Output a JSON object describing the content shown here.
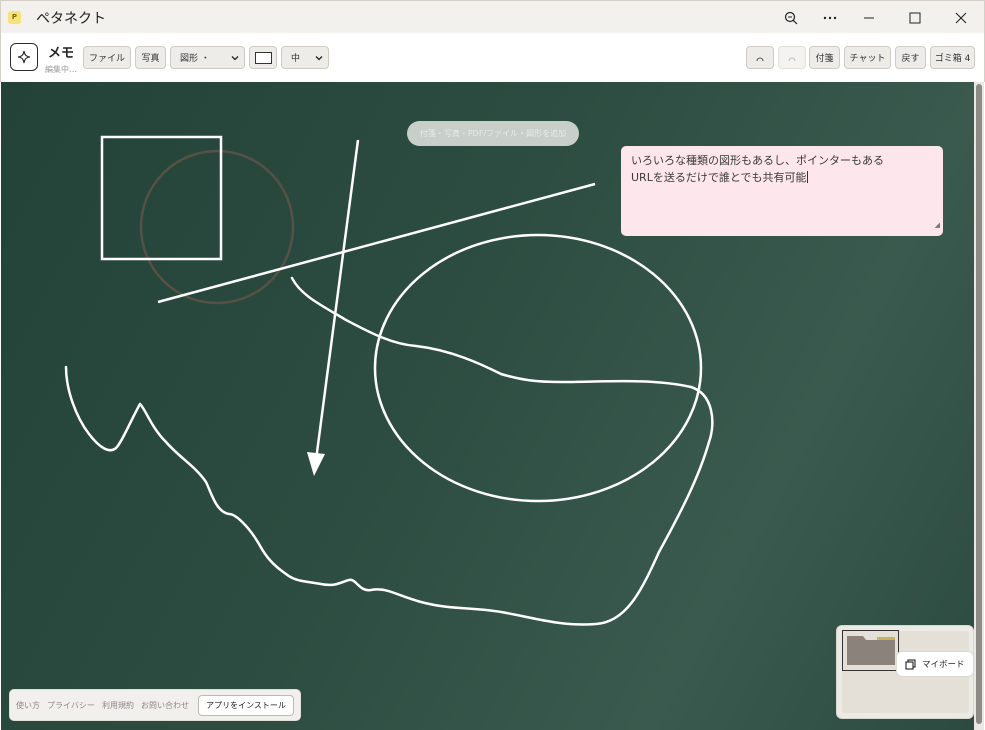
{
  "window": {
    "app_icon_letter": "P",
    "title": "ペタネクト"
  },
  "toolbar": {
    "memo_title": "メモ",
    "memo_status": "編集中…",
    "file_label": "ファイル",
    "photo_label": "写真",
    "shape_select_value": "図形 ・",
    "size_select_value": "中",
    "sticky_label": "付箋",
    "chat_label": "チャット",
    "back_label": "戻す",
    "trash_label": "ゴミ箱 4"
  },
  "board": {
    "hint_text": "付箋・写真・PDF/ファイル・図形を追加",
    "sticky_note": {
      "line1": "いろいろな種類の図形もあるし、ポインターもある",
      "line2": "URLを送るだけで誰とでも共有可能"
    }
  },
  "footer": {
    "links": [
      "使い方",
      "プライバシー",
      "利用規約",
      "お問い合わせ"
    ],
    "install_label": "アプリをインストール"
  },
  "minimap": {
    "myboard_label": "マイボード"
  },
  "colors": {
    "board": "#2a4a3f",
    "sticky": "#fde6ec",
    "stroke": "#ffffff"
  }
}
